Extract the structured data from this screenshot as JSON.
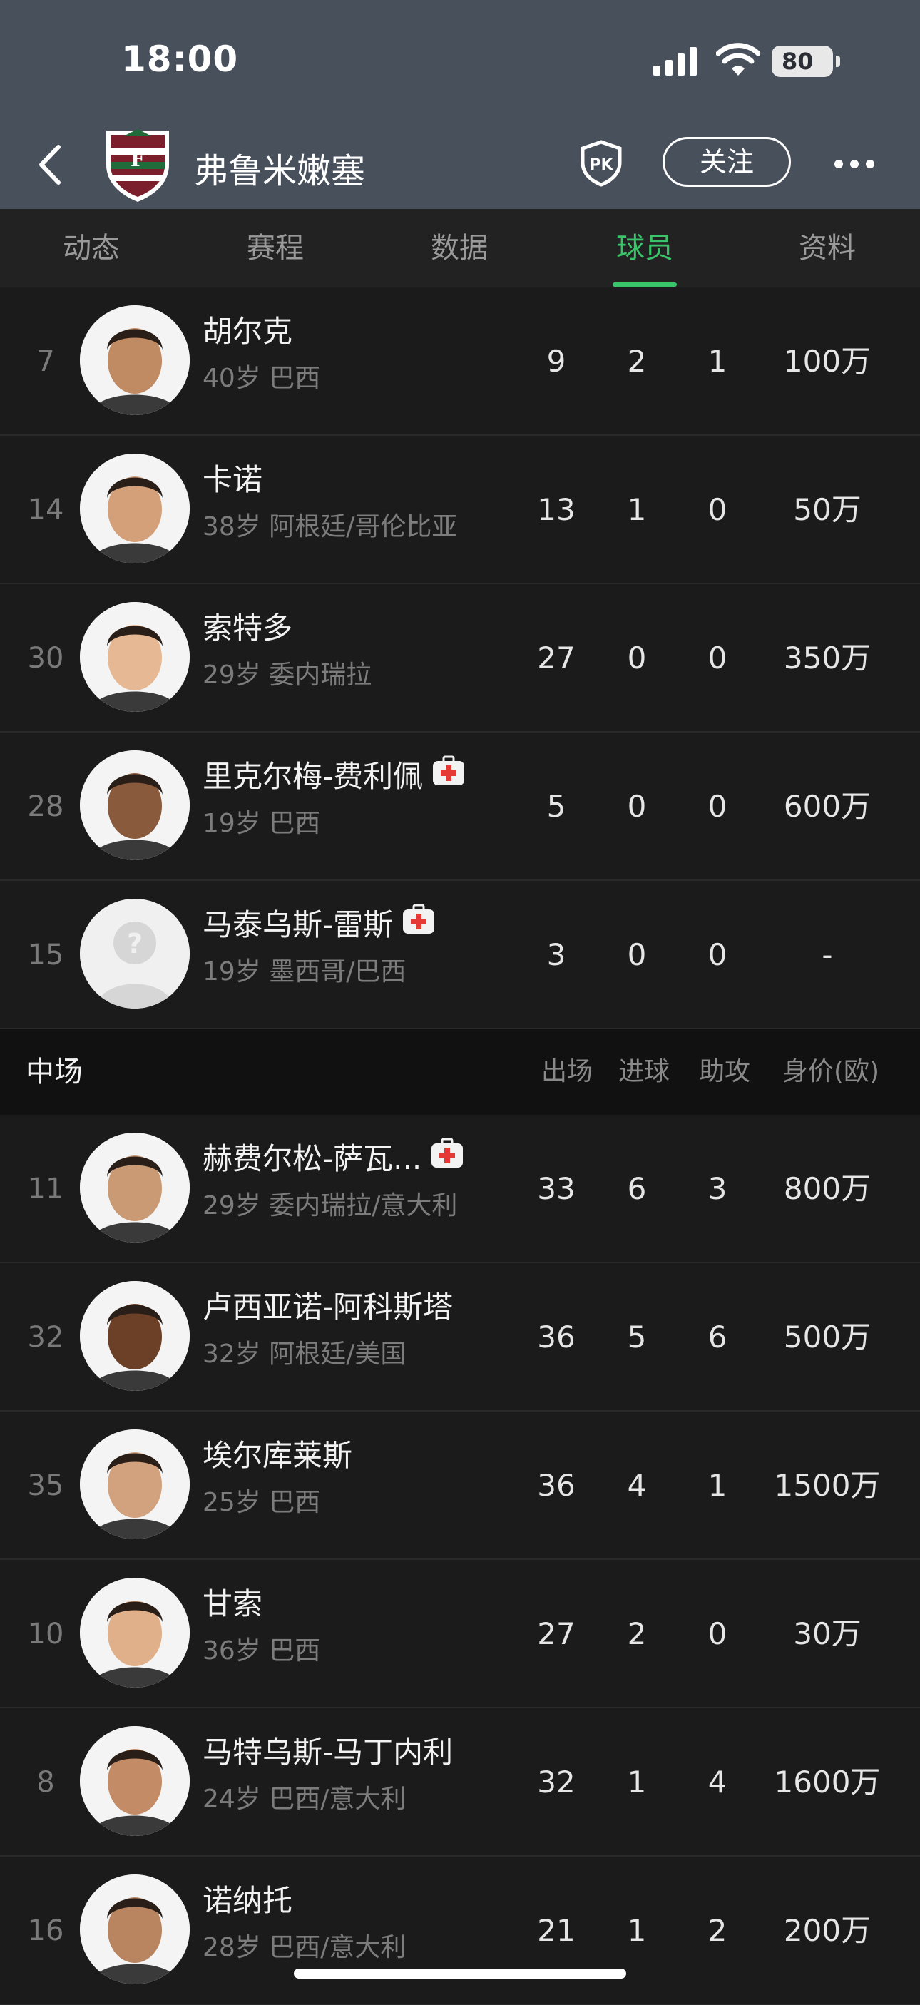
{
  "status_bar": {
    "time": "18:00",
    "battery": "80"
  },
  "nav": {
    "team_name": "弗鲁米嫩塞",
    "follow_label": "关注"
  },
  "tabs": [
    {
      "label": "动态",
      "active": false
    },
    {
      "label": "赛程",
      "active": false
    },
    {
      "label": "数据",
      "active": false
    },
    {
      "label": "球员",
      "active": true
    },
    {
      "label": "资料",
      "active": false
    }
  ],
  "forwards": [
    {
      "number": "7",
      "name": "胡尔克",
      "meta": "40岁 巴西",
      "injured": false,
      "apps": "9",
      "goals": "2",
      "assists": "1",
      "value": "100万"
    },
    {
      "number": "14",
      "name": "卡诺",
      "meta": "38岁 阿根廷/哥伦比亚",
      "injured": false,
      "apps": "13",
      "goals": "1",
      "assists": "0",
      "value": "50万"
    },
    {
      "number": "30",
      "name": "索特多",
      "meta": "29岁 委内瑞拉",
      "injured": false,
      "apps": "27",
      "goals": "0",
      "assists": "0",
      "value": "350万"
    },
    {
      "number": "28",
      "name": "里克尔梅-费利佩",
      "meta": "19岁 巴西",
      "injured": true,
      "apps": "5",
      "goals": "0",
      "assists": "0",
      "value": "600万"
    },
    {
      "number": "15",
      "name": "马泰乌斯-雷斯",
      "meta": "19岁 墨西哥/巴西",
      "injured": true,
      "placeholder_avatar": true,
      "apps": "3",
      "goals": "0",
      "assists": "0",
      "value": "-"
    }
  ],
  "midfield_section": {
    "title": "中场",
    "headers": {
      "apps": "出场",
      "goals": "进球",
      "assists": "助攻",
      "value": "身价(欧)"
    }
  },
  "midfielders": [
    {
      "number": "11",
      "name": "赫费尔松-萨瓦...",
      "meta": "29岁 委内瑞拉/意大利",
      "injured": true,
      "apps": "33",
      "goals": "6",
      "assists": "3",
      "value": "800万"
    },
    {
      "number": "32",
      "name": "卢西亚诺-阿科斯塔",
      "meta": "32岁 阿根廷/美国",
      "injured": false,
      "apps": "36",
      "goals": "5",
      "assists": "6",
      "value": "500万"
    },
    {
      "number": "35",
      "name": "埃尔库莱斯",
      "meta": "25岁 巴西",
      "injured": false,
      "apps": "36",
      "goals": "4",
      "assists": "1",
      "value": "1500万"
    },
    {
      "number": "10",
      "name": "甘索",
      "meta": "36岁 巴西",
      "injured": false,
      "apps": "27",
      "goals": "2",
      "assists": "0",
      "value": "30万"
    },
    {
      "number": "8",
      "name": "马特乌斯-马丁内利",
      "meta": "24岁 巴西/意大利",
      "injured": false,
      "apps": "32",
      "goals": "1",
      "assists": "4",
      "value": "1600万"
    },
    {
      "number": "16",
      "name": "诺纳托",
      "meta": "28岁 巴西/意大利",
      "injured": false,
      "apps": "21",
      "goals": "1",
      "assists": "2",
      "value": "200万"
    }
  ],
  "colors": {
    "accent_green": "#39c46a",
    "header_bg": "#48505c",
    "page_bg": "#1b1b1b"
  }
}
